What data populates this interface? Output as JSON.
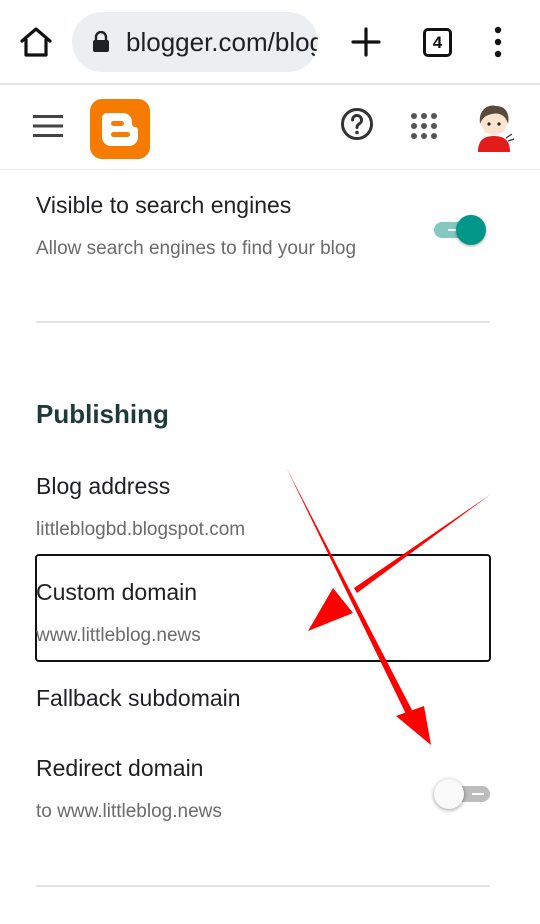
{
  "browser": {
    "url": "blogger.com/blog",
    "tab_count": "4",
    "icons": [
      "home-icon",
      "lock-icon",
      "plus-icon",
      "tab-switcher-icon",
      "more-vert-icon"
    ]
  },
  "app_bar": {
    "icons": [
      "menu-icon",
      "blogger-logo",
      "help-icon",
      "apps-grid-icon",
      "avatar"
    ],
    "brand_color": "#f57c00"
  },
  "settings": {
    "search_visibility": {
      "title": "Visible to search engines",
      "subtitle": "Allow search engines to find your blog",
      "enabled": true
    },
    "publishing": {
      "section_title": "Publishing",
      "blog_address": {
        "title": "Blog address",
        "value": "littleblogbd.blogspot.com"
      },
      "custom_domain": {
        "title": "Custom domain",
        "value": "www.littleblog.news"
      },
      "fallback_subdomain": {
        "title": "Fallback subdomain"
      },
      "redirect_domain": {
        "title": "Redirect domain",
        "subtitle": "to www.littleblog.news",
        "enabled": false
      }
    }
  },
  "colors": {
    "toggle_on": "#009688",
    "annotation_arrow": "#ff0000"
  }
}
